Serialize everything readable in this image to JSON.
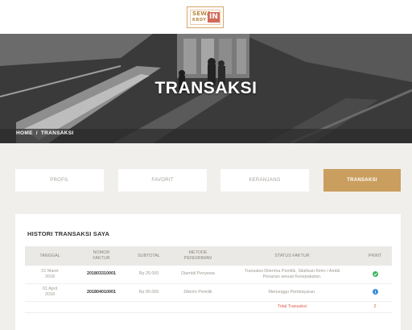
{
  "brand": {
    "logo_line1": "SEWA",
    "logo_line2": "KBDY",
    "logo_badge": "IN"
  },
  "hero": {
    "title": "TRANSAKSI",
    "breadcrumb": {
      "home": "HOME",
      "separator": "/",
      "current": "TRANSAKSI"
    }
  },
  "tabs": [
    {
      "label": "PROFIL",
      "active": false
    },
    {
      "label": "FAVORIT",
      "active": false
    },
    {
      "label": "KERANJANG",
      "active": false
    },
    {
      "label": "TRANSAKSI",
      "active": true
    }
  ],
  "history": {
    "title": "HISTORI TRANSAKSI SAYA",
    "headers": {
      "date": "TANGGAL",
      "invoice_1": "NOMOR",
      "invoice_2": "FAKTUR",
      "subtotal": "SUBTOTAL",
      "shipping_1": "METODE",
      "shipping_2": "PENGIRIMAN",
      "status": "STATUS FAKTUR",
      "print": "PRINT"
    },
    "rows": [
      {
        "date_1": "01 Maret",
        "date_2": "2018",
        "invoice": "201803310001",
        "subtotal": "Rp 25.000",
        "shipping": "Diambil Penyewa",
        "status_1": "Transaksi Diterima Pemilik, Silahkan Kirim / Ambil",
        "status_2": "Pesanan sesuai Kesepakatan.",
        "print_icon": "check-circle-icon"
      },
      {
        "date_1": "01 April",
        "date_2": "2018",
        "invoice": "201804010001",
        "subtotal": "Rp 95.000",
        "shipping": "Dikirim Pemilik",
        "status_1": "Menunggu Pembayaran.",
        "status_2": "",
        "print_icon": "info-circle-icon"
      }
    ],
    "total_label": "Total Transaksi",
    "total_value": "2"
  },
  "colors": {
    "accent": "#c99e5f",
    "danger": "#e05b4b",
    "success": "#3cb55f",
    "info": "#3a8bd6"
  }
}
